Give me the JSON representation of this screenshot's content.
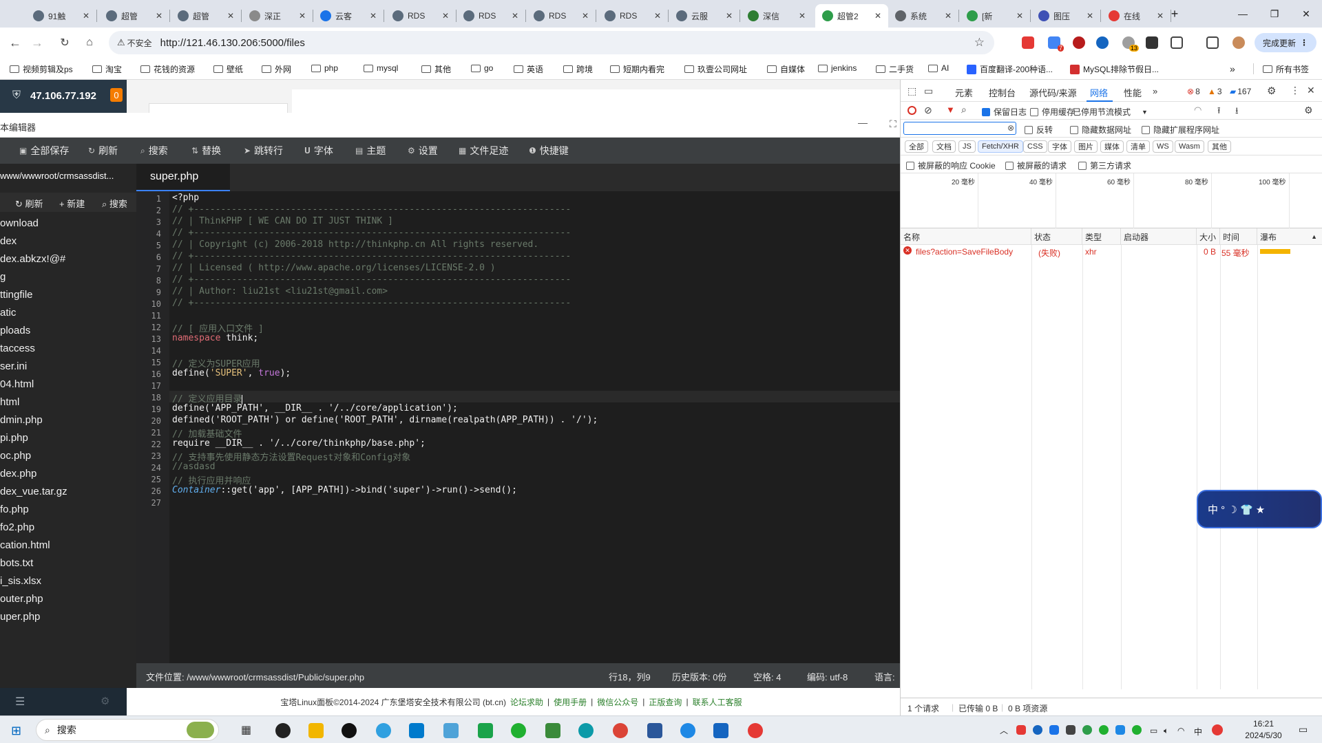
{
  "browser": {
    "tabs": [
      {
        "label": "91触",
        "icon_color": "#5b6b7c"
      },
      {
        "label": "超管",
        "icon_color": "#5b6b7c"
      },
      {
        "label": "超管",
        "icon_color": "#5b6b7c"
      },
      {
        "label": "深正",
        "icon_color": "#8a8a8a"
      },
      {
        "label": "云客",
        "icon_color": "#1a73e8"
      },
      {
        "label": "RDS",
        "icon_color": "#5b6b7c"
      },
      {
        "label": "RDS",
        "icon_color": "#5b6b7c"
      },
      {
        "label": "RDS",
        "icon_color": "#5b6b7c"
      },
      {
        "label": "RDS",
        "icon_color": "#5b6b7c"
      },
      {
        "label": "云服",
        "icon_color": "#5b6b7c"
      },
      {
        "label": "深信",
        "icon_color": "#2e7d32"
      },
      {
        "label": "超管2",
        "icon_color": "#2e9d4a",
        "active": true
      },
      {
        "label": "系统",
        "icon_color": "#5f6368"
      },
      {
        "label": "[新",
        "icon_color": "#2e9d4a"
      },
      {
        "label": "图压",
        "icon_color": "#3f51b5"
      },
      {
        "label": "在线",
        "icon_color": "#e53935"
      }
    ],
    "new_tab": "+",
    "window_controls": {
      "minimize": "—",
      "restore": "❐",
      "close": "✕"
    },
    "address": {
      "security": "不安全",
      "url": "http://121.46.130.206:5000/files"
    },
    "update_button": "完成更新",
    "ext_badges": {
      "ext2": "7",
      "ext6": "13"
    },
    "bookmarks": [
      {
        "label": "视频剪辑及ps",
        "type": "folder"
      },
      {
        "label": "淘宝",
        "type": "folder"
      },
      {
        "label": "花钱的资源",
        "type": "folder"
      },
      {
        "label": "壁纸",
        "type": "folder"
      },
      {
        "label": "外网",
        "type": "folder"
      },
      {
        "label": "php",
        "type": "folder"
      },
      {
        "label": "mysql",
        "type": "folder"
      },
      {
        "label": "其他",
        "type": "folder"
      },
      {
        "label": "go",
        "type": "folder"
      },
      {
        "label": "英语",
        "type": "folder"
      },
      {
        "label": "跨境",
        "type": "folder"
      },
      {
        "label": "短期内看完",
        "type": "folder"
      },
      {
        "label": "玖壹公司网址",
        "type": "folder"
      },
      {
        "label": "自媒体",
        "type": "folder"
      },
      {
        "label": "jenkins",
        "type": "folder"
      },
      {
        "label": "二手货",
        "type": "folder"
      },
      {
        "label": "AI",
        "type": "folder"
      },
      {
        "label": "百度翻译-200种语...",
        "type": "link"
      },
      {
        "label": "MySQL排除节假日...",
        "type": "link"
      }
    ],
    "bookmarks_more": "»",
    "all_bookmarks": "所有书签"
  },
  "panel": {
    "server_ip": "47.106.77.192",
    "notification_count": "0"
  },
  "editor": {
    "title": "本编辑器",
    "toolbar": [
      "全部保存",
      "刷新",
      "搜索",
      "替换",
      "跳转行",
      "字体",
      "主题",
      "设置",
      "文件足迹",
      "快捷键"
    ],
    "sidebar": {
      "path": "www/wwwroot/crmsassdist...",
      "actions": [
        "刷新",
        "新建",
        "搜索"
      ],
      "files": [
        "ownload",
        "dex",
        "dex.abkzx!@#",
        "g",
        "ttingfile",
        "atic",
        "ploads",
        "taccess",
        "ser.ini",
        "04.html",
        "html",
        "dmin.php",
        "pi.php",
        "oc.php",
        "dex.php",
        "dex_vue.tar.gz",
        "fo.php",
        "fo2.php",
        "cation.html",
        "bots.txt",
        "i_sis.xlsx",
        "outer.php",
        "uper.php"
      ]
    },
    "active_tab": "super.php",
    "status": {
      "file_location": "文件位置: /www/wwwroot/crmsassdist/Public/super.php",
      "position": "行18，列9",
      "history": "历史版本: 0份",
      "spaces": "空格: 4",
      "encoding": "编码: utf-8",
      "language": "语言:"
    }
  },
  "code": {
    "line_numbers": [
      "1",
      "2",
      "3",
      "4",
      "5",
      "6",
      "7",
      "8",
      "9",
      "10",
      "11",
      "12",
      "13",
      "14",
      "15",
      "16",
      "17",
      "18",
      "19",
      "20",
      "21",
      "22",
      "23",
      "24",
      "25",
      "26",
      "27"
    ],
    "l1": "<?php",
    "l2": "// +----------------------------------------------------------------------",
    "l3": "// | ThinkPHP [ WE CAN DO IT JUST THINK ]",
    "l4": "// +----------------------------------------------------------------------",
    "l5": "// | Copyright (c) 2006-2018 http://thinkphp.cn All rights reserved.",
    "l6": "// +----------------------------------------------------------------------",
    "l7": "// | Licensed ( http://www.apache.org/licenses/LICENSE-2.0 )",
    "l8": "// +----------------------------------------------------------------------",
    "l9": "// | Author: liu21st <liu21st@gmail.com>",
    "l10": "// +----------------------------------------------------------------------",
    "l12": "// [ 应用入口文件 ]",
    "l13_kw": "namespace",
    "l13_rest": " think;",
    "l15": "// 定义为SUPER应用",
    "l16_fn": "define(",
    "l16_str": "'SUPER'",
    "l16_rest": ", ",
    "l16_const": "true",
    "l16_end": ");",
    "l18": "// 定义应用目录",
    "l19": "define('APP_PATH', __DIR__ . '/../core/application');",
    "l20": "defined('ROOT_PATH') or define('ROOT_PATH', dirname(realpath(APP_PATH)) . '/');",
    "l21": "// 加载基础文件",
    "l22": "require __DIR__ . '/../core/thinkphp/base.php';",
    "l23": "// 支持事先使用静态方法设置Request对象和Config对象",
    "l24": "//asdasd",
    "l25": "// 执行应用并响应",
    "l26_cls": "Container",
    "l26_rest": "::get('app', [APP_PATH])->bind('super')->run()->send();"
  },
  "footer": {
    "copyright": "宝塔Linux面板©2014-2024 广东堡塔安全技术有限公司 (bt.cn)",
    "links": [
      "论坛求助",
      "使用手册",
      "微信公众号",
      "正版查询",
      "联系人工客服"
    ]
  },
  "devtools": {
    "tabs": [
      "元素",
      "控制台",
      "源代码/来源",
      "网络",
      "性能"
    ],
    "more": "»",
    "errors": "8",
    "warnings": "3",
    "messages": "167",
    "options": {
      "preserve_log": "保留日志",
      "disable_cache": "停用缓存",
      "throttle": "已停用节流模式"
    },
    "filter_options": {
      "invert": "反转",
      "hide_data_urls": "隐藏数据网址",
      "hide_ext_urls": "隐藏扩展程序网址"
    },
    "type_chips": [
      "全部",
      "文档",
      "JS",
      "Fetch/XHR",
      "CSS",
      "字体",
      "图片",
      "媒体",
      "清单",
      "WS",
      "Wasm",
      "其他"
    ],
    "blocked": {
      "cookies": "被屏蔽的响应 Cookie",
      "requests": "被屏蔽的请求",
      "third_party": "第三方请求"
    },
    "timeline_ticks": [
      "20 毫秒",
      "40 毫秒",
      "60 毫秒",
      "80 毫秒",
      "100 毫秒"
    ],
    "columns": [
      "名称",
      "状态",
      "类型",
      "启动器",
      "大小",
      "时间",
      "瀑布"
    ],
    "requests": [
      {
        "name": "files?action=SaveFileBody",
        "status": "(失败)",
        "type": "xhr",
        "initiator": "",
        "size": "0 B",
        "time": "55 毫秒",
        "waterfall_fraction": 0.5
      }
    ],
    "summary": {
      "requests": "1 个请求",
      "transferred": "已传输 0 B",
      "resources": "0 B 项资源"
    }
  },
  "widget": {
    "text": "中 ° ☽ 👕 ★"
  },
  "taskbar": {
    "search": "搜索",
    "time": "16:21",
    "date": "2024/5/30",
    "ime": "中"
  }
}
